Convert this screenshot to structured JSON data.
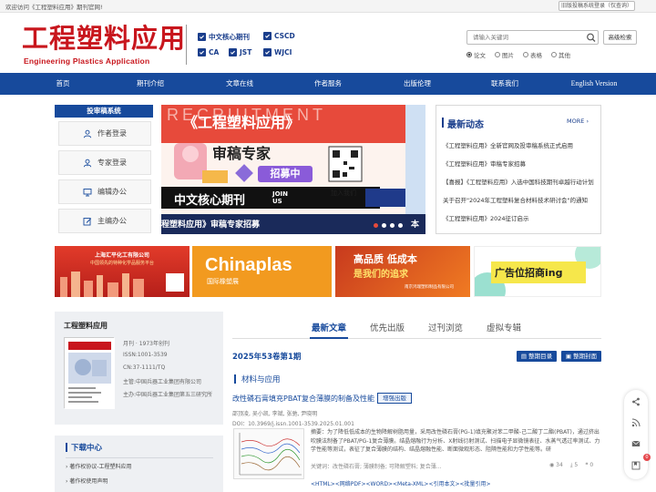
{
  "topbar": {
    "welcome": "欢迎访问《工程塑料应用》期刊官网!",
    "old_system": "旧版投稿系统登录（仅查询）"
  },
  "logo": {
    "cn": "工程塑料应用",
    "en": "Engineering Plastics Application"
  },
  "badges": [
    "中文核心期刊",
    "CSCD",
    "CA",
    "JST",
    "WJCI"
  ],
  "search": {
    "placeholder": "请输入关键词",
    "advanced": "高级检索",
    "options": [
      "论文",
      "图片",
      "表格",
      "其他"
    ],
    "selected": "论文"
  },
  "nav": [
    "首页",
    "期刊介绍",
    "文章在线",
    "作者服务",
    "出版伦理",
    "联系我们",
    "English Version"
  ],
  "submit": {
    "title": "投审稿系统",
    "items": [
      "作者登录",
      "专家登录",
      "编辑办公",
      "主编办公"
    ]
  },
  "banner": {
    "recruit_bg": "RECRUITMENT",
    "journal": "《工程塑料应用》",
    "headline": "审稿专家",
    "sub": "招募中",
    "core": "中文核心期刊",
    "join": "JOIN US",
    "join_cn": "加入我们",
    "caption": "程塑料应用》审稿专家招募",
    "caption_right": "本"
  },
  "news": {
    "title": "最新动态",
    "more": "MORE",
    "items": [
      "《工程塑料应用》全新官网及投审稿系统正式启用",
      "《工程塑料应用》审稿专家招募",
      "【喜报】《工程塑料应用》入选中国科技期刊卓越行动计划",
      "关于召开\"2024年工程塑料复合材料技术研讨会\"的通知",
      "《工程塑料应用》2024征订启示"
    ]
  },
  "ads": {
    "ad1_title": "上海汇平化工有限公司",
    "ad1_sub": "中国领先的特种化学品服务平台",
    "ad2_title": "Chinaplas",
    "ad2_sub": "国际橡塑展",
    "ad3_title1": "高品质 低成本",
    "ad3_title2": "是我们的追求",
    "ad3_foot": "南京鸿瑞塑料制品有限公司",
    "ad4_title": "广告位招商ing"
  },
  "journal_info": {
    "title": "工程塑料应用",
    "lines": [
      "月刊 · 1973年创刊",
      "ISSN:1001-3539",
      "CN:37-1111/TQ",
      "主管:中国兵器工业集团有限公司",
      "主办:中国兵器工业集团第五三研究所"
    ]
  },
  "download": {
    "title": "下载中心",
    "items": [
      "著作权协议-工程塑料应用",
      "著作权使用声明"
    ]
  },
  "tabs": [
    "最新文章",
    "优先出版",
    "过刊浏览",
    "虚拟专辑"
  ],
  "issue": {
    "label": "2025年53卷第1期",
    "btn_toc": "整期目录",
    "btn_cover": "整期封面"
  },
  "section": "材料与应用",
  "article": {
    "title": "改性磷石膏填充PBAT复合薄膜的制备及性能",
    "tag": "增强出版",
    "authors": "邵顶凌, 吴小凯, 李斌, 张驰, 尹晓明",
    "doi": "DOI：10.3969/j.issn.1001-3539.2025.01.001",
    "abstract": "摘要：为了降低低成本的生物降解树脂用量，采用改性磷石膏(PG-1)填充聚对苯二甲酸-己二酸丁二酯(PBAT)，通过挤出吹膜法制备了PBAT/PG-1复合薄膜。结晶熔融行为分析、X射线衍射测试、扫描电子显微镜表征、水蒸气透过率测试、力学性能等测试，表征了复合薄膜的结构、结晶熔融性能、断面微观形态、阻隔性能和力学性能等。研",
    "keywords": "关键词：改性磷石膏; 薄膜制备; 可降解塑料; 复合薄...",
    "views": "34",
    "downloads": "5",
    "cites": "0",
    "links": "<HTML><网络PDF><WORD><Meta-XML><引用本文><批量引用>"
  },
  "float_badge": "0",
  "colors": {
    "brand_blue": "#174a9c",
    "logo_red": "#c8161d"
  }
}
